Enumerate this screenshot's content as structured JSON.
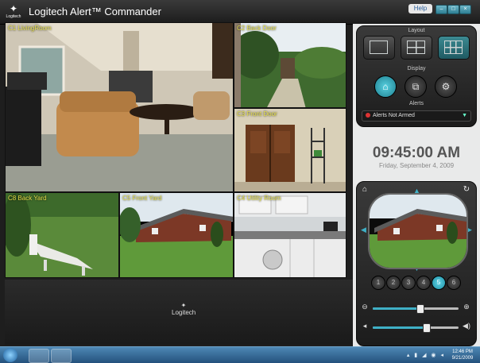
{
  "window": {
    "title": "Logitech Alert™ Commander",
    "logo_text": "Logitech",
    "help_label": "Help",
    "controls": [
      "minimize-icon",
      "restore-icon",
      "close-icon"
    ]
  },
  "cameras": [
    {
      "label": "C1 LivingRoom"
    },
    {
      "label": "C2 Back Door"
    },
    {
      "label": "C3 Front Door"
    },
    {
      "label": "C8 Back Yard"
    },
    {
      "label": "C5 Front Yard"
    },
    {
      "label": "C4 Utility Room"
    }
  ],
  "lower_logo": "Logitech",
  "panel": {
    "layout_title": "Layout",
    "display_title": "Display",
    "alerts_title": "Alerts",
    "alerts_value": "Alerts Not Armed",
    "time": "09:45:00 AM",
    "date": "Friday, September 4, 2009",
    "presets": [
      "1",
      "2",
      "3",
      "4",
      "5",
      "6"
    ],
    "active_preset": "5",
    "zoom_level": 0.55,
    "volume_level": 0.62
  },
  "taskbar": {
    "clock_time": "12:46 PM",
    "clock_date": "9/21/2009"
  },
  "colors": {
    "accent": "#3fb0c6",
    "label": "#e7e04a",
    "alert_dot": "#dd3333"
  }
}
